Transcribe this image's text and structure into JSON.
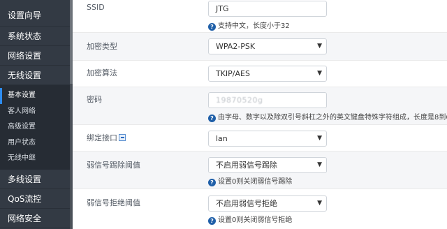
{
  "sidebar": {
    "items": [
      {
        "label": "设置向导"
      },
      {
        "label": "系统状态"
      },
      {
        "label": "网络设置"
      },
      {
        "label": "无线设置"
      }
    ],
    "submenu": [
      {
        "label": "基本设置",
        "active": true
      },
      {
        "label": "客人网络"
      },
      {
        "label": "高级设置"
      },
      {
        "label": "用户状态"
      },
      {
        "label": "无线中继"
      }
    ],
    "items_after": [
      {
        "label": "多线设置"
      },
      {
        "label": "QoS流控"
      },
      {
        "label": "网络安全"
      }
    ]
  },
  "form": {
    "ssid": {
      "label": "SSID",
      "value": "JTG",
      "hint": "支持中文，长度小于32"
    },
    "encryption_type": {
      "label": "加密类型",
      "value": "WPA2-PSK"
    },
    "encryption_algo": {
      "label": "加密算法",
      "value": "TKIP/AES"
    },
    "password": {
      "label": "密码",
      "value": "19870520g",
      "hint": "由字母、数字以及除双引号斜杠之外的英文键盘特殊字符组成，长度是8到6"
    },
    "bind_interface": {
      "label": "绑定接口",
      "value": "lan"
    },
    "weak_kick": {
      "label": "弱信号踢除阈值",
      "value": "不启用弱信号踢除",
      "hint": "设置0则关闭弱信号踢除"
    },
    "weak_reject": {
      "label": "弱信号拒绝阈值",
      "value": "不启用弱信号拒绝",
      "hint": "设置0则关闭弱信号拒绝"
    }
  },
  "icons": {
    "help": "help-circle-icon",
    "caret": "caret-down-icon",
    "link": "link-icon"
  },
  "colors": {
    "sidebar_bg": "#333a44",
    "active_accent": "#2d8cf0",
    "help_icon": "#1f5fa8"
  }
}
